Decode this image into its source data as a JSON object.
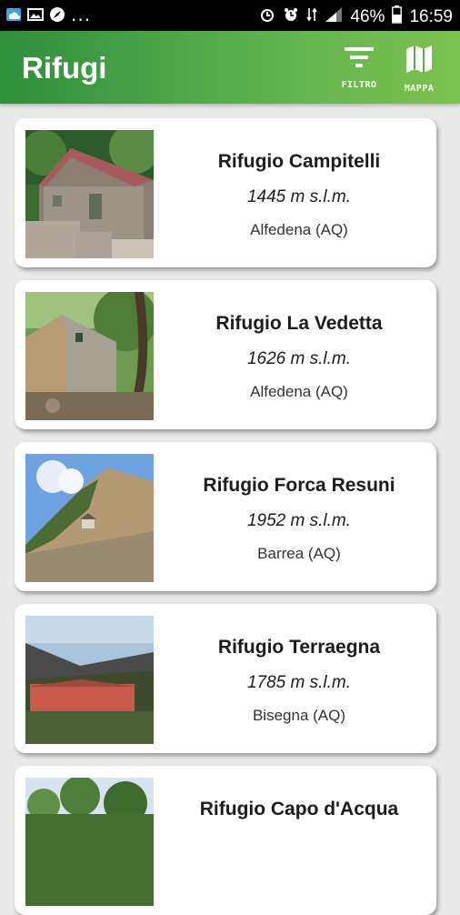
{
  "status_bar": {
    "battery": "46%",
    "time": "16:59",
    "overflow": "..."
  },
  "app_bar": {
    "title": "Rifugi",
    "filter_label": "FILTRO",
    "map_label": "MAPPA"
  },
  "refuges": [
    {
      "name": "Rifugio Campitelli",
      "altitude": "1445 m s.l.m.",
      "location": "Alfedena (AQ)"
    },
    {
      "name": "Rifugio La Vedetta",
      "altitude": "1626 m s.l.m.",
      "location": "Alfedena (AQ)"
    },
    {
      "name": "Rifugio Forca Resuni",
      "altitude": "1952 m s.l.m.",
      "location": "Barrea (AQ)"
    },
    {
      "name": "Rifugio Terraegna",
      "altitude": "1785 m s.l.m.",
      "location": "Bisegna (AQ)"
    },
    {
      "name": "Rifugio Capo d'Acqua",
      "altitude": "",
      "location": ""
    }
  ],
  "colors": {
    "appbar_start": "#2f8f3c",
    "appbar_end": "#7cc24f"
  }
}
